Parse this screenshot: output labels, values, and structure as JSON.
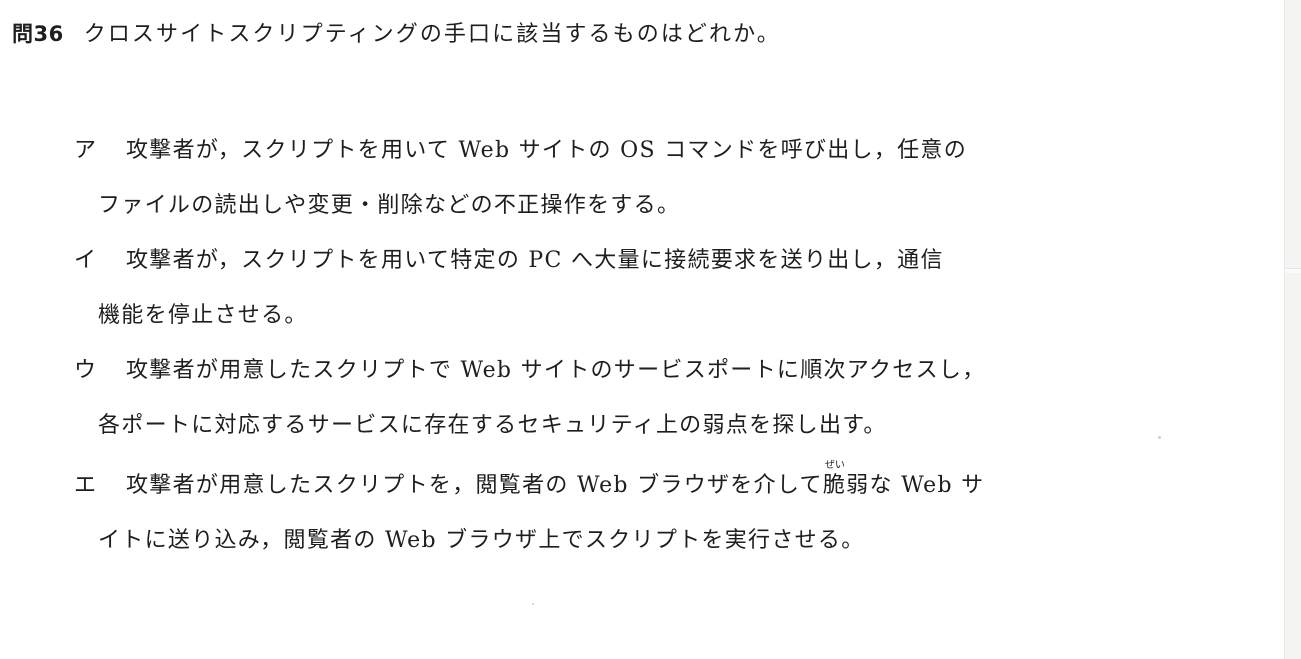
{
  "question": {
    "number": "問36",
    "text": "クロスサイトスクリプティングの手口に該当するものはどれか。"
  },
  "choices": [
    {
      "label": "ア",
      "line1": "攻撃者が，スクリプトを用いて Web サイトの OS コマンドを呼び出し，任意の",
      "line2": "ファイルの読出しや変更・削除などの不正操作をする。"
    },
    {
      "label": "イ",
      "line1": "攻撃者が，スクリプトを用いて特定の PC へ大量に接続要求を送り出し，通信",
      "line2": "機能を停止させる。"
    },
    {
      "label": "ウ",
      "line1": "攻撃者が用意したスクリプトで Web サイトのサービスポートに順次アクセスし，",
      "line2": "各ポートに対応するサービスに存在するセキュリティ上の弱点を探し出す。"
    },
    {
      "label": "エ",
      "line1_before": "攻撃者が用意したスクリプトを，閲覧者の Web ブラウザを介して",
      "line1_ruby_base": "脆",
      "line1_ruby_text": "ぜい",
      "line1_after": "弱な Web サ",
      "line2": "イトに送り込み，閲覧者の Web ブラウザ上でスクリプトを実行させる。"
    }
  ]
}
